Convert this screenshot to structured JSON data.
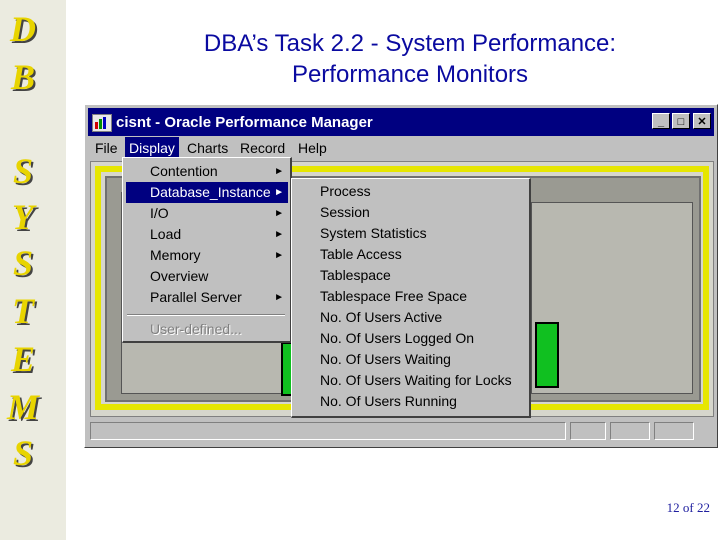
{
  "side_letters": [
    "D",
    "B",
    "S",
    "Y",
    "S",
    "T",
    "E",
    "M",
    "S"
  ],
  "slide": {
    "title_line1": "DBA’s Task 2.2 - System Performance:",
    "title_line2": "Performance Monitors",
    "page_number": "12 of 22"
  },
  "window": {
    "title": "cisnt - Oracle Performance Manager",
    "controls": {
      "minimize": "_",
      "maximize": "□",
      "close": "✕"
    },
    "menubar": [
      "File",
      "Display",
      "Charts",
      "Record",
      "Help"
    ],
    "active_menu": "Display"
  },
  "display_menu": {
    "items": [
      {
        "label": "Contention",
        "submenu": true
      },
      {
        "label": "Database_Instance",
        "submenu": true,
        "selected": true
      },
      {
        "label": "I/O",
        "submenu": true
      },
      {
        "label": "Load",
        "submenu": true
      },
      {
        "label": "Memory",
        "submenu": true
      },
      {
        "label": "Overview",
        "submenu": false
      },
      {
        "label": "Parallel Server",
        "submenu": true
      }
    ],
    "disabled_item": "User-defined...",
    "arrow": "►"
  },
  "instance_submenu": {
    "items": [
      "Process",
      "Session",
      "System Statistics",
      "Table Access",
      "Tablespace",
      "Tablespace Free Space",
      "No. Of Users Active",
      "No. Of Users Logged On",
      "No. Of Users Waiting",
      "No. Of Users Waiting for Locks",
      "No. Of Users Running"
    ]
  },
  "colors": {
    "slide_title": "#0a0aa0",
    "side_letters": "#e8d400",
    "titlebar": "#000080",
    "menu_highlight": "#000080",
    "client_border": "#e6e600"
  }
}
